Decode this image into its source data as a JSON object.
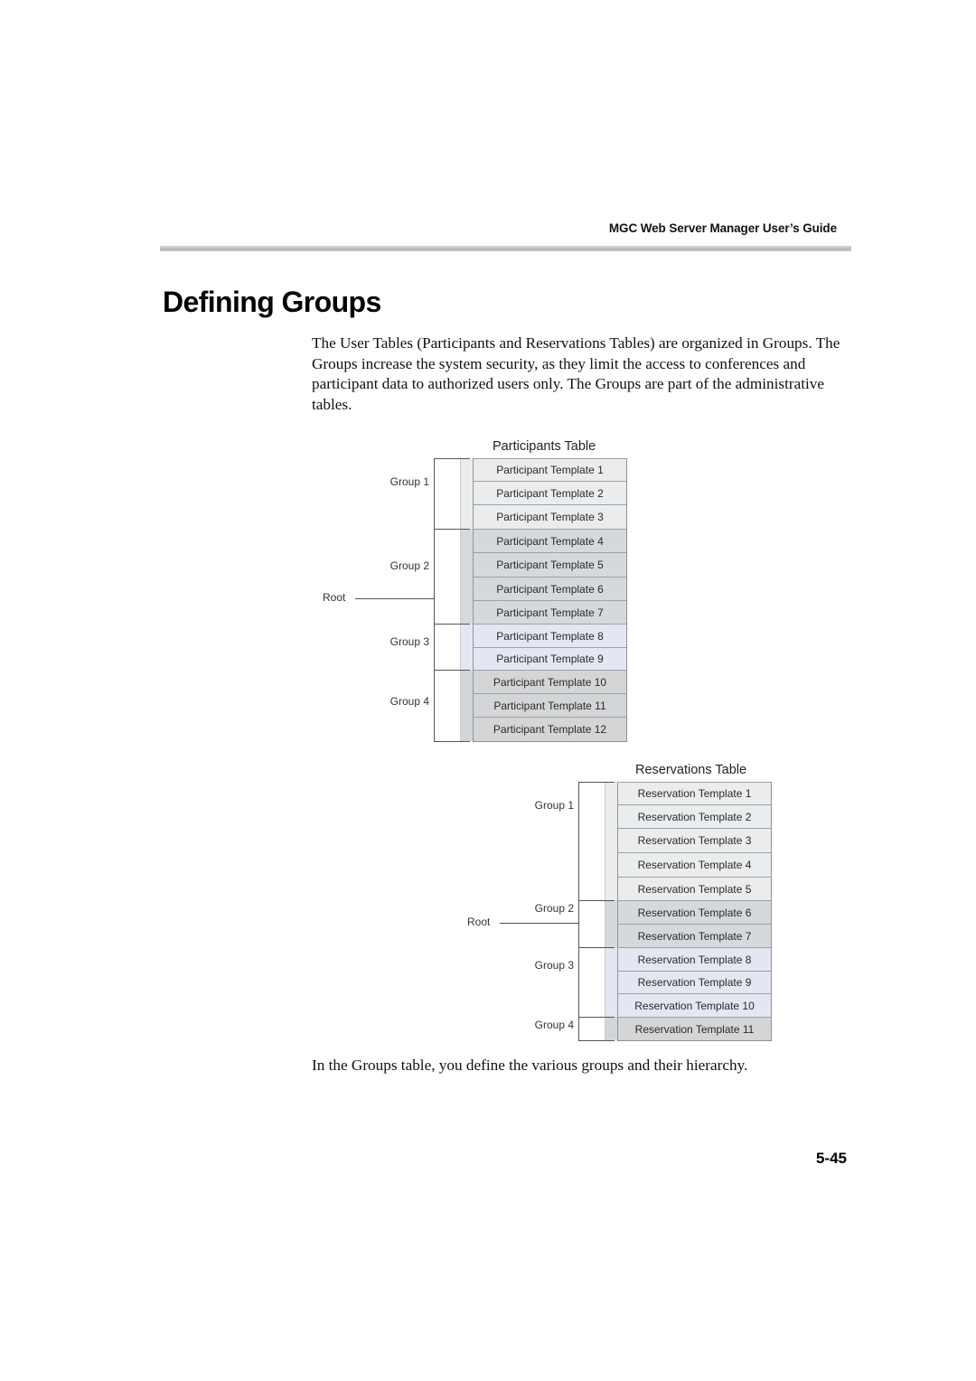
{
  "header": {
    "running_head": "MGC Web Server Manager User’s Guide"
  },
  "section": {
    "title": "Defining Groups",
    "intro": "The User Tables (Participants and Reservations Tables) are organized in Groups. The Groups increase the system security, as they limit the access to conferences and participant data to authorized users only. The Groups are part of the administrative tables.",
    "outro": "In the Groups table, you define the various groups and their hierarchy."
  },
  "footer": {
    "page_number": "5-45"
  },
  "colors": {
    "group1": "#ebeced",
    "group2": "#d5d9dc",
    "group3": "#e3e7f1",
    "group4": "#d3d5d7"
  },
  "diagrams": [
    {
      "id": "participants",
      "title": "Participants Table",
      "root_label": "Root",
      "groups": [
        {
          "label": "Group 1",
          "items": [
            "Participant Template 1",
            "Participant Template 2",
            "Participant Template 3"
          ]
        },
        {
          "label": "Group 2",
          "items": [
            "Participant Template 4",
            "Participant Template 5",
            "Participant Template 6",
            "Participant Template 7"
          ]
        },
        {
          "label": "Group 3",
          "items": [
            "Participant Template 8",
            "Participant Template 9"
          ]
        },
        {
          "label": "Group 4",
          "items": [
            "Participant Template 10",
            "Participant Template 11",
            "Participant Template 12"
          ]
        }
      ]
    },
    {
      "id": "reservations",
      "title": "Reservations Table",
      "root_label": "Root",
      "groups": [
        {
          "label": "Group 1",
          "items": [
            "Reservation Template 1",
            "Reservation Template 2",
            "Reservation Template 3",
            "Reservation Template 4",
            "Reservation Template 5"
          ]
        },
        {
          "label": "Group 2",
          "items": [
            "Reservation Template 6",
            "Reservation Template 7"
          ]
        },
        {
          "label": "Group 3",
          "items": [
            "Reservation Template 8",
            "Reservation Template 9",
            "Reservation Template 10"
          ]
        },
        {
          "label": "Group 4",
          "items": [
            "Reservation Template 11"
          ]
        }
      ]
    }
  ]
}
